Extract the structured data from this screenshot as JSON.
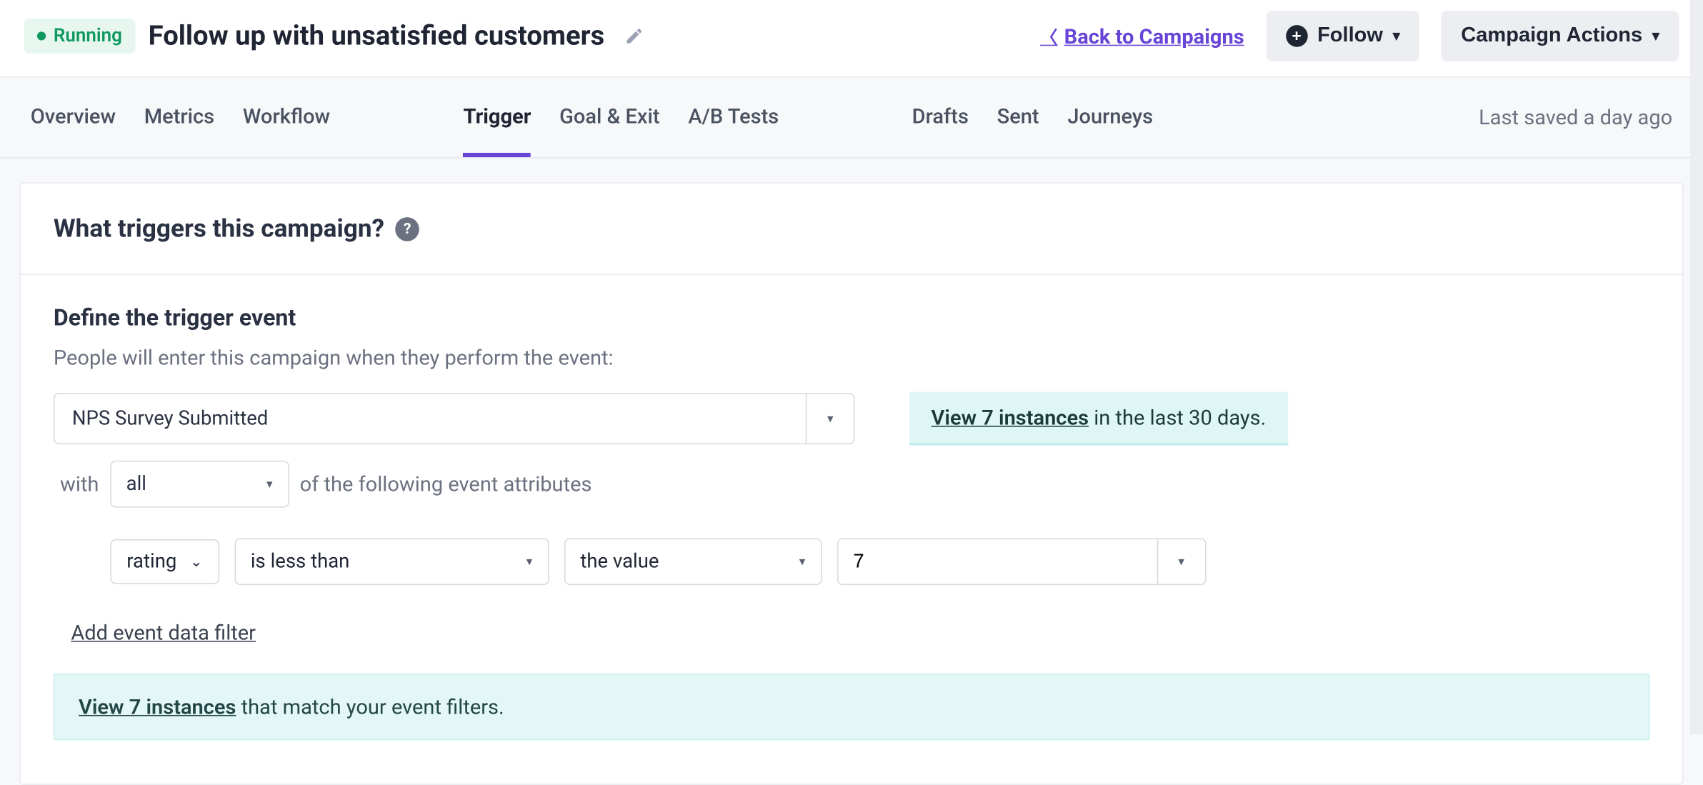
{
  "header": {
    "status": "Running",
    "title": "Follow up with unsatisfied customers",
    "back_link": "Back to Campaigns",
    "follow_btn": "Follow",
    "actions_btn": "Campaign Actions"
  },
  "tabs": {
    "overview": "Overview",
    "metrics": "Metrics",
    "workflow": "Workflow",
    "trigger": "Trigger",
    "goal_exit": "Goal & Exit",
    "ab_tests": "A/B Tests",
    "drafts": "Drafts",
    "sent": "Sent",
    "journeys": "Journeys",
    "saved": "Last saved a day ago"
  },
  "panel": {
    "heading": "What triggers this campaign?",
    "define_heading": "Define the trigger event",
    "define_sub": "People will enter this campaign when they perform the event:",
    "event_name": "NPS Survey Submitted",
    "instances_link": "View 7 instances",
    "instances_rest": " in the last 30 days.",
    "with_label": "with",
    "quantifier": "all",
    "with_rest": "of the following event attributes",
    "attr": "rating",
    "operator": "is less than",
    "value_type": "the value",
    "value": "7",
    "add_filter": "Add event data filter",
    "match_link": "View 7 instances",
    "match_rest": " that match your event filters."
  }
}
